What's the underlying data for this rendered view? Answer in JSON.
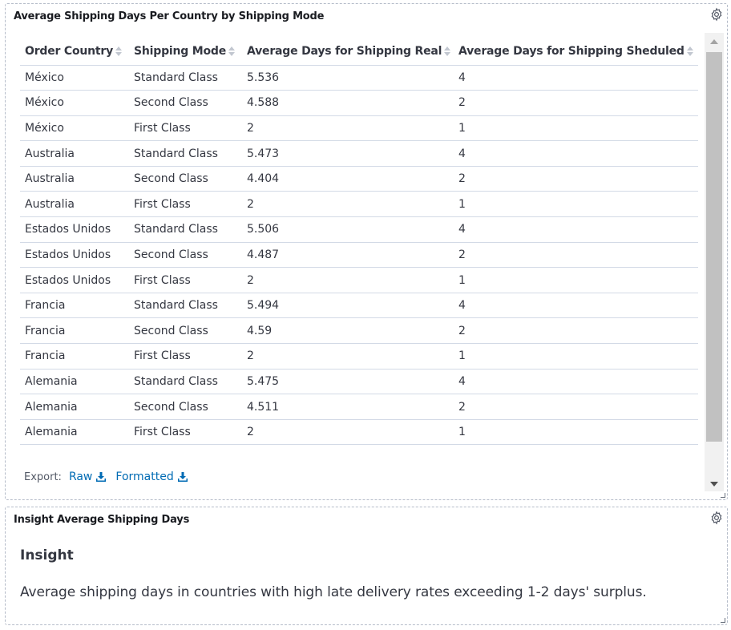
{
  "table_panel": {
    "title": "Average Shipping Days Per Country by Shipping Mode",
    "columns": [
      "Order Country",
      "Shipping Mode",
      "Average Days for Shipping Real",
      "Average Days for Shipping Sheduled"
    ],
    "rows": [
      [
        "México",
        "Standard Class",
        "5.536",
        "4"
      ],
      [
        "México",
        "Second Class",
        "4.588",
        "2"
      ],
      [
        "México",
        "First Class",
        "2",
        "1"
      ],
      [
        "Australia",
        "Standard Class",
        "5.473",
        "4"
      ],
      [
        "Australia",
        "Second Class",
        "4.404",
        "2"
      ],
      [
        "Australia",
        "First Class",
        "2",
        "1"
      ],
      [
        "Estados Unidos",
        "Standard Class",
        "5.506",
        "4"
      ],
      [
        "Estados Unidos",
        "Second Class",
        "4.487",
        "2"
      ],
      [
        "Estados Unidos",
        "First Class",
        "2",
        "1"
      ],
      [
        "Francia",
        "Standard Class",
        "5.494",
        "4"
      ],
      [
        "Francia",
        "Second Class",
        "4.59",
        "2"
      ],
      [
        "Francia",
        "First Class",
        "2",
        "1"
      ],
      [
        "Alemania",
        "Standard Class",
        "5.475",
        "4"
      ],
      [
        "Alemania",
        "Second Class",
        "4.511",
        "2"
      ],
      [
        "Alemania",
        "First Class",
        "2",
        "1"
      ]
    ],
    "export": {
      "label": "Export:",
      "raw_label": "Raw",
      "formatted_label": "Formatted"
    }
  },
  "insight_panel": {
    "title": "Insight Average Shipping Days",
    "heading": "Insight",
    "text": "Average shipping days in countries with high late delivery rates exceeding 1-2 days' surplus."
  },
  "icons": {
    "settings": "gear-icon",
    "download": "download-icon",
    "resize": "resize-handle-icon"
  },
  "colors": {
    "link": "#006bb4",
    "text": "#343741",
    "border": "#d3dae6"
  }
}
